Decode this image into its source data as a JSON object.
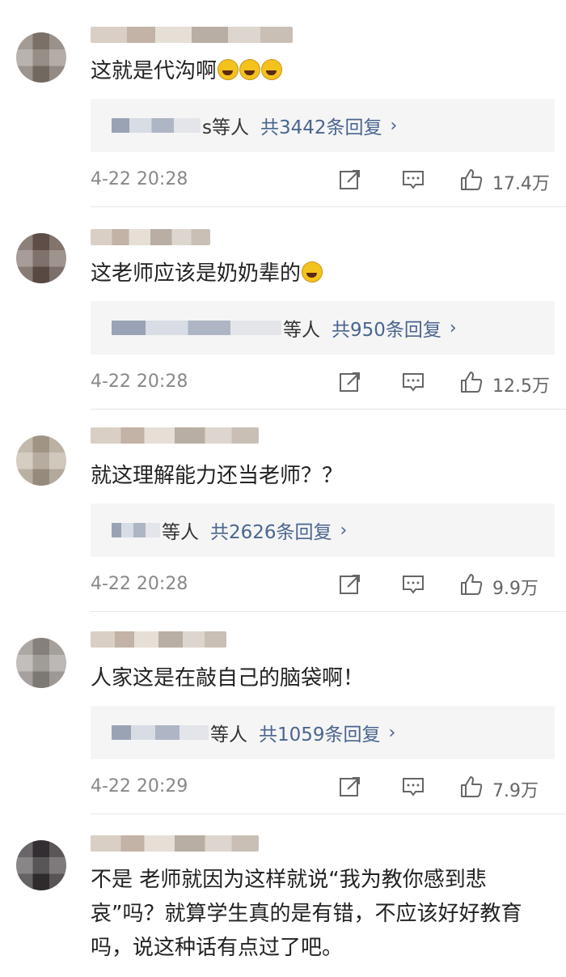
{
  "comments": [
    {
      "text": "这就是代沟啊",
      "reply_people": "s等人",
      "reply_count": "共3442条回复",
      "timestamp": "4-22 20:28",
      "like_count": "17.4万",
      "emoji_icon": "laughing-tears-emoji"
    },
    {
      "text": "这老师应该是奶奶辈的",
      "reply_people": "等人",
      "reply_count": "共950条回复",
      "timestamp": "4-22 20:28",
      "like_count": "12.5万",
      "emoji_icon": "laughing-tears-emoji"
    },
    {
      "text": "就这理解能力还当老师？？",
      "reply_people": "等人",
      "reply_count": "共2626条回复",
      "timestamp": "4-22 20:28",
      "like_count": "9.9万"
    },
    {
      "text": "人家这是在敲自己的脑袋啊！",
      "reply_people": "等人",
      "reply_count": "共1059条回复",
      "timestamp": "4-22 20:29",
      "like_count": "7.9万"
    },
    {
      "text": "不是 老师就因为这样就说“我为教你感到悲哀”吗？就算学生真的是有错，不应该好好教育吗，说这种话有点过了吧。"
    }
  ],
  "colors": {
    "link": "#4a6590",
    "timestamp": "#888888",
    "reply_box_bg": "#f5f5f5"
  },
  "icons": [
    "share-icon",
    "reply-icon",
    "like-icon",
    "chevron-right-icon"
  ]
}
